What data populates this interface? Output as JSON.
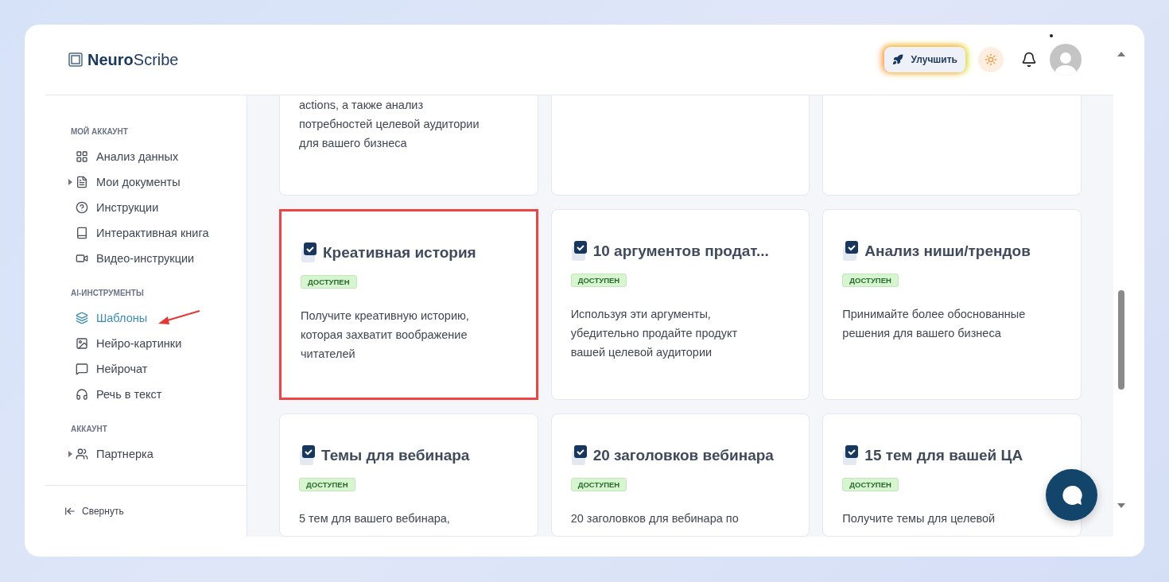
{
  "logo": {
    "bold": "Neuro",
    "rest": "Scribe"
  },
  "header": {
    "upgrade_button": "Улучшить",
    "notification_dot": true
  },
  "sidebar": {
    "sections": [
      {
        "title": "МОЙ АККАУНТ",
        "items": [
          {
            "label": "Анализ данных",
            "expandable": false,
            "selected": false,
            "pointed": false
          },
          {
            "label": "Мои документы",
            "expandable": true,
            "selected": false,
            "pointed": false
          },
          {
            "label": "Инструкции",
            "expandable": false,
            "selected": false,
            "pointed": false
          },
          {
            "label": "Интерактивная книга",
            "expandable": false,
            "selected": false,
            "pointed": false
          },
          {
            "label": "Видео-инструкции",
            "expandable": false,
            "selected": false,
            "pointed": false
          }
        ]
      },
      {
        "title": "AI-ИНСТРУМЕНТЫ",
        "items": [
          {
            "label": "Шаблоны",
            "expandable": false,
            "selected": true,
            "pointed": true
          },
          {
            "label": "Нейро-картинки",
            "expandable": false,
            "selected": false,
            "pointed": false
          },
          {
            "label": "Нейрочат",
            "expandable": false,
            "selected": false,
            "pointed": false
          },
          {
            "label": "Речь в текст",
            "expandable": false,
            "selected": false,
            "pointed": false
          }
        ]
      },
      {
        "title": "АККАУНТ",
        "items": [
          {
            "label": "Партнерка",
            "expandable": true,
            "selected": false,
            "pointed": false
          }
        ]
      }
    ],
    "collapse": "Свернуть"
  },
  "cards": [
    {
      "cut": true,
      "highlighted": false,
      "lines": [
        "actions, а также анализ",
        "потребностей целевой аудитории",
        "для вашего бизнеса"
      ]
    },
    {
      "cut": true,
      "highlighted": false
    },
    {
      "cut": true,
      "highlighted": false
    },
    {
      "cut": false,
      "highlighted": true,
      "title": "Креативная история",
      "badge": "ДОСТУПЕН",
      "lines": [
        "Получите креативную историю,",
        "которая захватит воображение",
        "читателей"
      ]
    },
    {
      "cut": false,
      "highlighted": false,
      "title": "10 аргументов продат...",
      "badge": "ДОСТУПЕН",
      "lines": [
        "Используя эти аргументы,",
        "убедительно продайте продукт",
        "вашей целевой аудитории"
      ]
    },
    {
      "cut": false,
      "highlighted": false,
      "title": "Анализ ниши/трендов",
      "badge": "ДОСТУПЕН",
      "lines": [
        "Принимайте более обоснованные",
        "решения для вашего бизнеса"
      ]
    },
    {
      "cut": false,
      "highlighted": false,
      "title": "Темы для вебинара",
      "badge": "ДОСТУПЕН",
      "lines": [
        "5 тем для вашего вебинара,"
      ]
    },
    {
      "cut": false,
      "highlighted": false,
      "title": "20 заголовков вебинара",
      "badge": "ДОСТУПЕН",
      "lines": [
        "20 заголовков для вебинара по"
      ]
    },
    {
      "cut": false,
      "highlighted": false,
      "title": "15 тем для вашей ЦА",
      "badge": "ДОСТУПЕН",
      "lines": [
        "Получите темы для целевой"
      ]
    }
  ]
}
